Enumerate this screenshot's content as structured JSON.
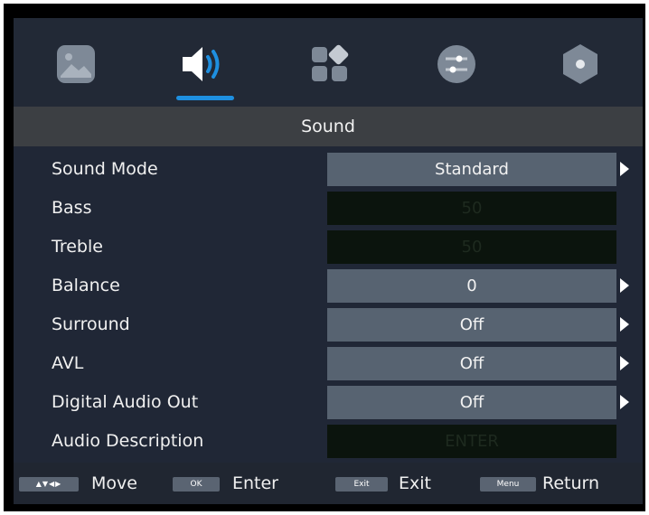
{
  "tabs": [
    {
      "icon": "picture-icon",
      "selected": false
    },
    {
      "icon": "speaker-icon",
      "selected": true
    },
    {
      "icon": "apps-icon",
      "selected": false
    },
    {
      "icon": "sliders-icon",
      "selected": false
    },
    {
      "icon": "hexagon-icon",
      "selected": false
    }
  ],
  "title": "Sound",
  "settings": [
    {
      "label": "Sound Mode",
      "value": "Standard",
      "enabled": true,
      "has_arrow": true
    },
    {
      "label": "Bass",
      "value": "50",
      "enabled": false,
      "has_arrow": false
    },
    {
      "label": "Treble",
      "value": "50",
      "enabled": false,
      "has_arrow": false
    },
    {
      "label": "Balance",
      "value": "0",
      "enabled": true,
      "has_arrow": true
    },
    {
      "label": "Surround",
      "value": "Off",
      "enabled": true,
      "has_arrow": true
    },
    {
      "label": "AVL",
      "value": "Off",
      "enabled": true,
      "has_arrow": true
    },
    {
      "label": "Digital Audio Out",
      "value": "Off",
      "enabled": true,
      "has_arrow": true
    },
    {
      "label": "Audio Description",
      "value": "ENTER",
      "enabled": false,
      "has_arrow": false
    }
  ],
  "footer": {
    "move_key": "▲▼◀▶",
    "move_label": "Move",
    "ok_key": "OK",
    "enter_label": "Enter",
    "exit_key": "Exit",
    "exit_label": "Exit",
    "menu_key": "Menu",
    "return_label": "Return"
  },
  "colors": {
    "accent": "#1e8fe0",
    "active_value_bg": "#576371",
    "disabled_value_bg": "#0b140d",
    "panel_bg": "#202736"
  }
}
